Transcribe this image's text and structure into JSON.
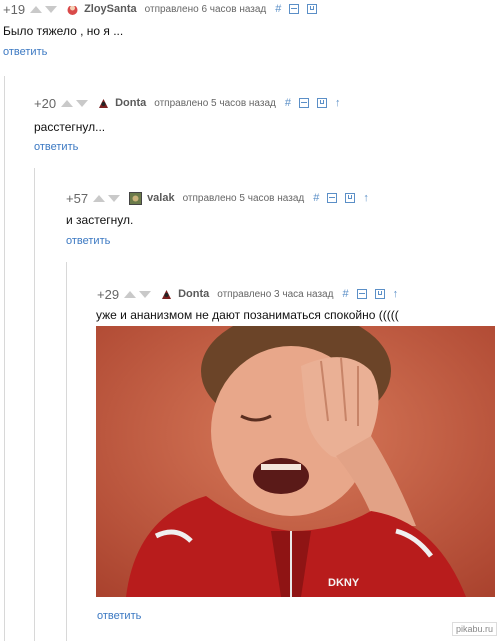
{
  "comments": [
    {
      "rating": "+19",
      "author": "ZloySanta",
      "time": "отправлено 6 часов назад",
      "text": "Было тяжело , но я ...",
      "reply_label": "ответить"
    },
    {
      "rating": "+20",
      "author": "Donta",
      "time": "отправлено 5 часов назад",
      "text": "расстегнул...",
      "reply_label": "ответить"
    },
    {
      "rating": "+57",
      "author": "valak",
      "time": "отправлено 5 часов назад",
      "text": "и застегнул.",
      "reply_label": "ответить"
    },
    {
      "rating": "+29",
      "author": "Donta",
      "time": "отправлено 3 часа назад",
      "text": "уже и ананизмом не дают позаниматься спокойно (((((",
      "reply_label": "ответить"
    }
  ],
  "image_text": "DKNY",
  "watermark": "pikabu.ru",
  "colors": {
    "link": "#3b78c2",
    "icon": "#5b8fc7",
    "rating": "#666666",
    "thread_line": "#d8d8d8"
  },
  "icons": [
    "up-vote-icon",
    "down-vote-icon",
    "hash-icon",
    "collapse-icon",
    "save-icon",
    "parent-arrow-icon"
  ]
}
